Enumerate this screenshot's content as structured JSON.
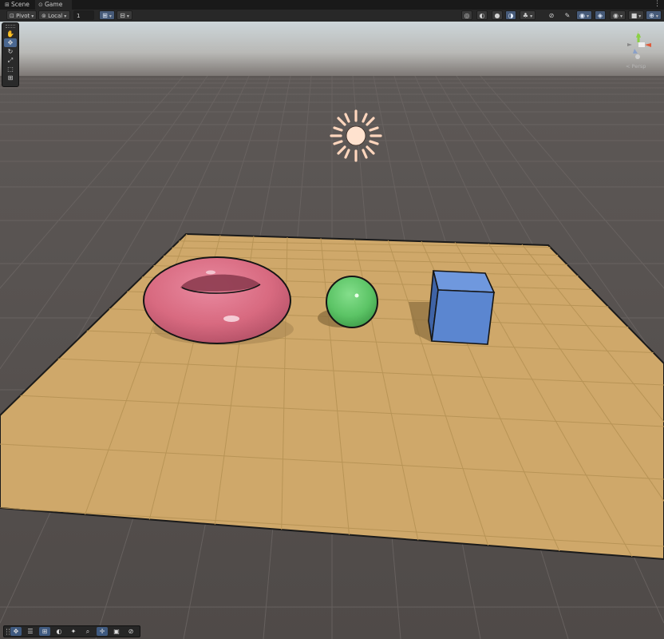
{
  "tabs": [
    {
      "label": "Scene",
      "icon": "grid-icon",
      "active": false
    },
    {
      "label": "Game",
      "icon": "gamepad-icon",
      "active": true
    }
  ],
  "toolbar": {
    "pivot_label": "Pivot",
    "space_label": "Local",
    "grid_snap_value": "1",
    "right_icons": [
      "orientation-icon",
      "draw-mode-icon",
      "shaded-icon",
      "wireframe-icon",
      "lighting-icon",
      "audio-icon",
      "fx-icon",
      "visibility-icon",
      "hidden-objects-icon",
      "camera-icon",
      "gizmos-icon"
    ]
  },
  "tools": [
    "hand-tool",
    "move-tool",
    "rotate-tool",
    "scale-tool",
    "rect-tool",
    "transform-tool"
  ],
  "gizmo": {
    "projection_label": "< Persp"
  },
  "bottom_overlay": [
    "move-icon",
    "layers-icon",
    "grid-icon",
    "circle-icon",
    "lights-icon",
    "zoom-icon",
    "transform-icon",
    "display-icon",
    "navigation-icon"
  ],
  "colors": {
    "sky": "#c9d2d6",
    "ground": "#595452",
    "plane": "#cfa86a",
    "torus": "#d86a80",
    "sphere": "#5cc466",
    "cube": "#5b86d0",
    "sun": "#ffd9c2",
    "accent": "#4a6790"
  }
}
